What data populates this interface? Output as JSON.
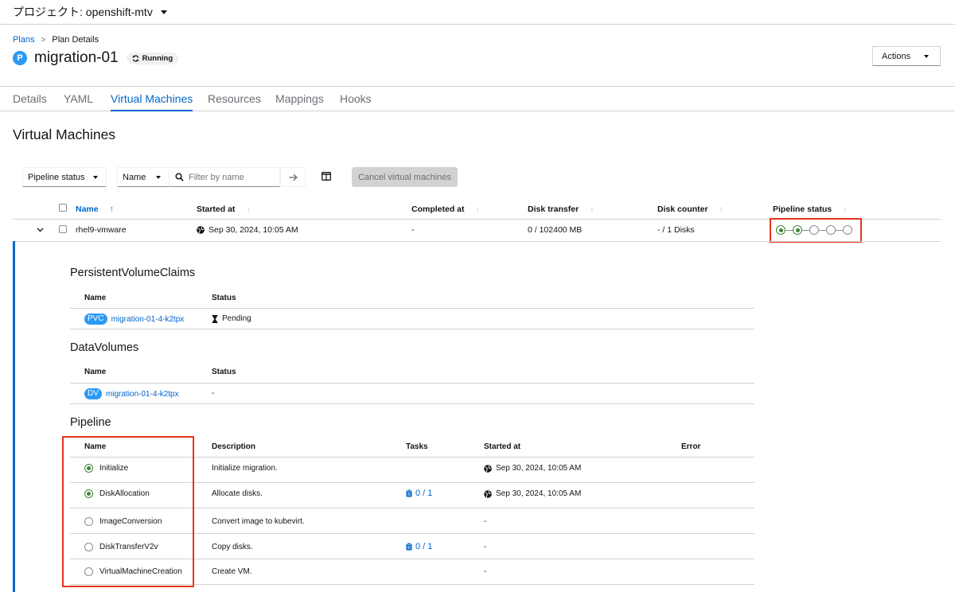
{
  "project": {
    "label": "プロジェクト: openshift-mtv"
  },
  "breadcrumb": {
    "plans": "Plans",
    "separator": ">",
    "current": "Plan Details"
  },
  "plan": {
    "badge": "P",
    "name": "migration-01",
    "status": "Running"
  },
  "actions_label": "Actions",
  "tabs": [
    "Details",
    "YAML",
    "Virtual Machines",
    "Resources",
    "Mappings",
    "Hooks"
  ],
  "active_tab": "Virtual Machines",
  "section_title": "Virtual Machines",
  "toolbar": {
    "pipeline_filter": "Pipeline status",
    "name_filter": "Name",
    "search_placeholder": "Filter by name",
    "cancel_label": "Cancel virtual machines"
  },
  "vm_table": {
    "headers": [
      "Name",
      "Started at",
      "Completed at",
      "Disk transfer",
      "Disk counter",
      "Pipeline status"
    ],
    "sort_arrow": "↑",
    "row": {
      "name": "rhel9-vmware",
      "started_at": "Sep 30, 2024, 10:05 AM",
      "completed_at": "-",
      "disk_transfer": "0 / 102400 MB",
      "disk_counter": "- / 1 Disks",
      "pipeline_steps_done": 2,
      "pipeline_steps_total": 5
    }
  },
  "pvc": {
    "title": "PersistentVolumeClaims",
    "headers": [
      "Name",
      "Status"
    ],
    "badge": "PVC",
    "name": "migration-01-4-k2tpx",
    "status": "Pending"
  },
  "dv": {
    "title": "DataVolumes",
    "headers": [
      "Name",
      "Status"
    ],
    "badge": "DV",
    "name": "migration-01-4-k2tpx",
    "status": "-"
  },
  "pipeline": {
    "title": "Pipeline",
    "headers": [
      "Name",
      "Description",
      "Tasks",
      "Started at",
      "Error"
    ],
    "rows": [
      {
        "name": "Initialize",
        "description": "Initialize migration.",
        "tasks": "",
        "started": "Sep 30, 2024, 10:05 AM",
        "done": true
      },
      {
        "name": "DiskAllocation",
        "description": "Allocate disks.",
        "tasks": "0 / 1",
        "started": "Sep 30, 2024, 10:05 AM",
        "done": true
      },
      {
        "name": "ImageConversion",
        "description": "Convert image to kubevirt.",
        "tasks": "",
        "started": "-",
        "done": false
      },
      {
        "name": "DiskTransferV2v",
        "description": "Copy disks.",
        "tasks": "0 / 1",
        "started": "-",
        "done": false
      },
      {
        "name": "VirtualMachineCreation",
        "description": "Create VM.",
        "tasks": "",
        "started": "-",
        "done": false
      }
    ]
  },
  "colors": {
    "link": "#0066cc",
    "done": "#3e8635",
    "highlight": "#e8341c",
    "badge": "#2b9af3"
  }
}
